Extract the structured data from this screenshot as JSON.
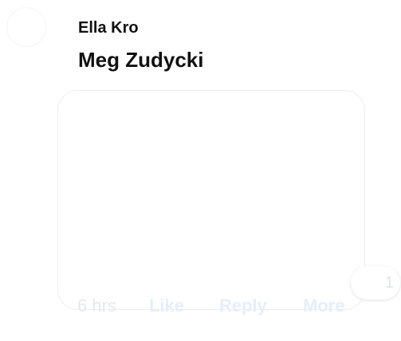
{
  "comment": {
    "author_top": "Ella Kro",
    "author_main": "Meg Zudycki",
    "timestamp": "6 hrs",
    "actions": {
      "like": "Like",
      "reply": "Reply",
      "more": "More"
    },
    "reaction_count": "1"
  }
}
